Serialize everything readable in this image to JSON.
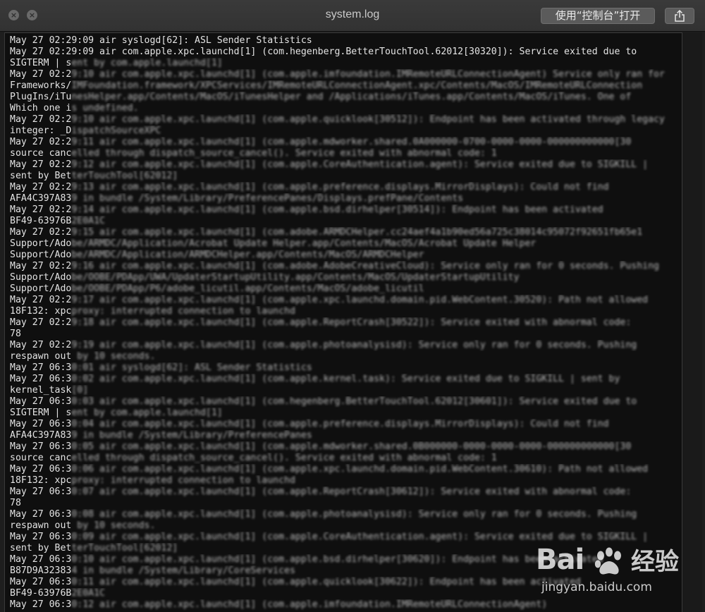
{
  "window": {
    "title": "system.log",
    "open_button_label": "使用“控制台”打开",
    "close_glyph": "×",
    "minimize_glyph": "×"
  },
  "icons": {
    "close": "close-icon",
    "minimize": "minimize-icon",
    "share": "share-icon"
  },
  "log": {
    "lines": [
      {
        "clear": "May 27 02:29:09 air syslogd[62]: ASL Sender Statistics",
        "blurred": ""
      },
      {
        "clear": "May 27 02:29:09 air com.apple.xpc.launchd[1] (com.hegenberg.BetterTouchTool.62012[30320]): Service exited due to",
        "blurred": ""
      },
      {
        "clear": "SIGTERM | s",
        "blurred": "ent by com.apple.launchd[1]"
      },
      {
        "clear": "May 27 02:2",
        "blurred": "9:10 air com.apple.xpc.launchd[1] (com.apple.imfoundation.IMRemoteURLConnectionAgent) Service only ran for"
      },
      {
        "clear": "Frameworks/",
        "blurred": "IMFoundation.framework/XPCServices/IMRemoteURLConnectionAgent.xpc/Contents/MacOS/IMRemoteURLConnection"
      },
      {
        "clear": "PlugIns/iTu",
        "blurred": "nesHelper.app/Contents/MacOS/iTunesHelper and /Applications/iTunes.app/Contents/MacOS/iTunes. One of"
      },
      {
        "clear": "Which one i",
        "blurred": "s undefined."
      },
      {
        "clear": "May 27 02:2",
        "blurred": "9:10 air com.apple.xpc.launchd[1] (com.apple.quicklook[30512]): Endpoint has been activated through legacy"
      },
      {
        "clear": "integer: _D",
        "blurred": "ispatchSourceXPC"
      },
      {
        "clear": "May 27 02:2",
        "blurred": "9:11 air com.apple.xpc.launchd[1] (com.apple.mdworker.shared.0A000000-0700-0000-0000-000000000000[30"
      },
      {
        "clear": "source canc",
        "blurred": "elled through dispatch_source_cancel(). Service exited with abnormal code: 1"
      },
      {
        "clear": "May 27 02:2",
        "blurred": "9:12 air com.apple.xpc.launchd[1] (com.apple.CoreAuthentication.agent): Service exited due to SIGKILL |"
      },
      {
        "clear": "sent by Bet",
        "blurred": "terTouchTool[62012]"
      },
      {
        "clear": "May 27 02:2",
        "blurred": "9:13 air com.apple.xpc.launchd[1] (com.apple.preference.displays.MirrorDisplays): Could not find"
      },
      {
        "clear": "AFA4C397A83",
        "blurred": "9 in bundle /System/Library/PreferencePanes/Displays.prefPane/Contents"
      },
      {
        "clear": "May 27 02:2",
        "blurred": "9:14 air com.apple.xpc.launchd[1] (com.apple.bsd.dirhelper[30514]): Endpoint has been activated"
      },
      {
        "clear": "BF49-63976B",
        "blurred": "2E0A1C"
      },
      {
        "clear": "May 27 02:2",
        "blurred": "9:15 air com.apple.xpc.launchd[1] (com.adobe.ARMDCHelper.cc24aef4a1b90ed56a725c38014c95072f92651fb65e1"
      },
      {
        "clear": "Support/Ado",
        "blurred": "be/ARMDC/Application/Acrobat Update Helper.app/Contents/MacOS/Acrobat Update Helper"
      },
      {
        "clear": "Support/Ado",
        "blurred": "be/ARMDC/Application/ARMDCHelper.app/Contents/MacOS/ARMDCHelper"
      },
      {
        "clear": "May 27 02:2",
        "blurred": "9:16 air com.apple.xpc.launchd[1] (com.adobe.AdobeCreativeCloud): Service only ran for 0 seconds. Pushing"
      },
      {
        "clear": "Support/Ado",
        "blurred": "be/OOBE/PDApp/UWA/UpdaterStartupUtility.app/Contents/MacOS/UpdaterStartupUtility"
      },
      {
        "clear": "Support/Ado",
        "blurred": "be/OOBE/PDApp/P6/adobe_licutil.app/Contents/MacOS/adobe_licutil"
      },
      {
        "clear": "May 27 02:2",
        "blurred": "9:17 air com.apple.xpc.launchd[1] (com.apple.xpc.launchd.domain.pid.WebContent.30520): Path not allowed"
      },
      {
        "clear": "18F132: xpc",
        "blurred": "proxy: interrupted connection to launchd"
      },
      {
        "clear": "May 27 02:2",
        "blurred": "9:18 air com.apple.xpc.launchd[1] (com.apple.ReportCrash[30522]): Service exited with abnormal code:"
      },
      {
        "clear": "78",
        "blurred": ""
      },
      {
        "clear": "May 27 02:2",
        "blurred": "9:19 air com.apple.xpc.launchd[1] (com.apple.photoanalysisd): Service only ran for 0 seconds. Pushing"
      },
      {
        "clear": "respawn out",
        "blurred": " by 10 seconds."
      },
      {
        "clear": "May 27 06:3",
        "blurred": "0:01 air syslogd[62]: ASL Sender Statistics"
      },
      {
        "clear": "May 27 06:3",
        "blurred": "0:02 air com.apple.xpc.launchd[1] (com.apple.kernel.task): Service exited due to SIGKILL | sent by"
      },
      {
        "clear": "kernel_task",
        "blurred": "[0]"
      },
      {
        "clear": "May 27 06:3",
        "blurred": "0:03 air com.apple.xpc.launchd[1] (com.hegenberg.BetterTouchTool.62012[30601]): Service exited due to"
      },
      {
        "clear": "SIGTERM | s",
        "blurred": "ent by com.apple.launchd[1]"
      },
      {
        "clear": "May 27 06:3",
        "blurred": "0:04 air com.apple.xpc.launchd[1] (com.apple.preference.displays.MirrorDisplays): Could not find"
      },
      {
        "clear": "AFA4C397A83",
        "blurred": "9 in bundle /System/Library/PreferencePanes"
      },
      {
        "clear": "May 27 06:3",
        "blurred": "0:05 air com.apple.xpc.launchd[1] (com.apple.mdworker.shared.0B000000-0000-0000-0000-000000000000[30"
      },
      {
        "clear": "source canc",
        "blurred": "elled through dispatch_source_cancel(). Service exited with abnormal code: 1"
      },
      {
        "clear": "May 27 06:3",
        "blurred": "0:06 air com.apple.xpc.launchd[1] (com.apple.xpc.launchd.domain.pid.WebContent.30610): Path not allowed"
      },
      {
        "clear": "18F132: xpc",
        "blurred": "proxy: interrupted connection to launchd"
      },
      {
        "clear": "May 27 06:3",
        "blurred": "0:07 air com.apple.xpc.launchd[1] (com.apple.ReportCrash[30612]): Service exited with abnormal code:"
      },
      {
        "clear": "78",
        "blurred": ""
      },
      {
        "clear": "May 27 06:3",
        "blurred": "0:08 air com.apple.xpc.launchd[1] (com.apple.photoanalysisd): Service only ran for 0 seconds. Pushing"
      },
      {
        "clear": "respawn out",
        "blurred": " by 10 seconds."
      },
      {
        "clear": "May 27 06:3",
        "blurred": "0:09 air com.apple.xpc.launchd[1] (com.apple.CoreAuthentication.agent): Service exited due to SIGKILL |"
      },
      {
        "clear": "sent by Bet",
        "blurred": "terTouchTool[62012]"
      },
      {
        "clear": "May 27 06:3",
        "blurred": "0:10 air com.apple.xpc.launchd[1] (com.apple.bsd.dirhelper[30620]): Endpoint has been activated"
      },
      {
        "clear": "B87D9A32383",
        "blurred": "4 in bundle /System/Library/CoreServices"
      },
      {
        "clear": "May 27 06:3",
        "blurred": "0:11 air com.apple.xpc.launchd[1] (com.apple.quicklook[30622]): Endpoint has been activated"
      },
      {
        "clear": "BF49-63976B",
        "blurred": "2E0A1C"
      },
      {
        "clear": "May 27 06:3",
        "blurred": "0:12 air com.apple.xpc.launchd[1] (com.apple.imfoundation.IMRemoteURLConnectionAgent)"
      }
    ]
  },
  "watermark": {
    "logo": "Bai",
    "chinese": "经验",
    "url": "jingyan.baidu.com"
  }
}
